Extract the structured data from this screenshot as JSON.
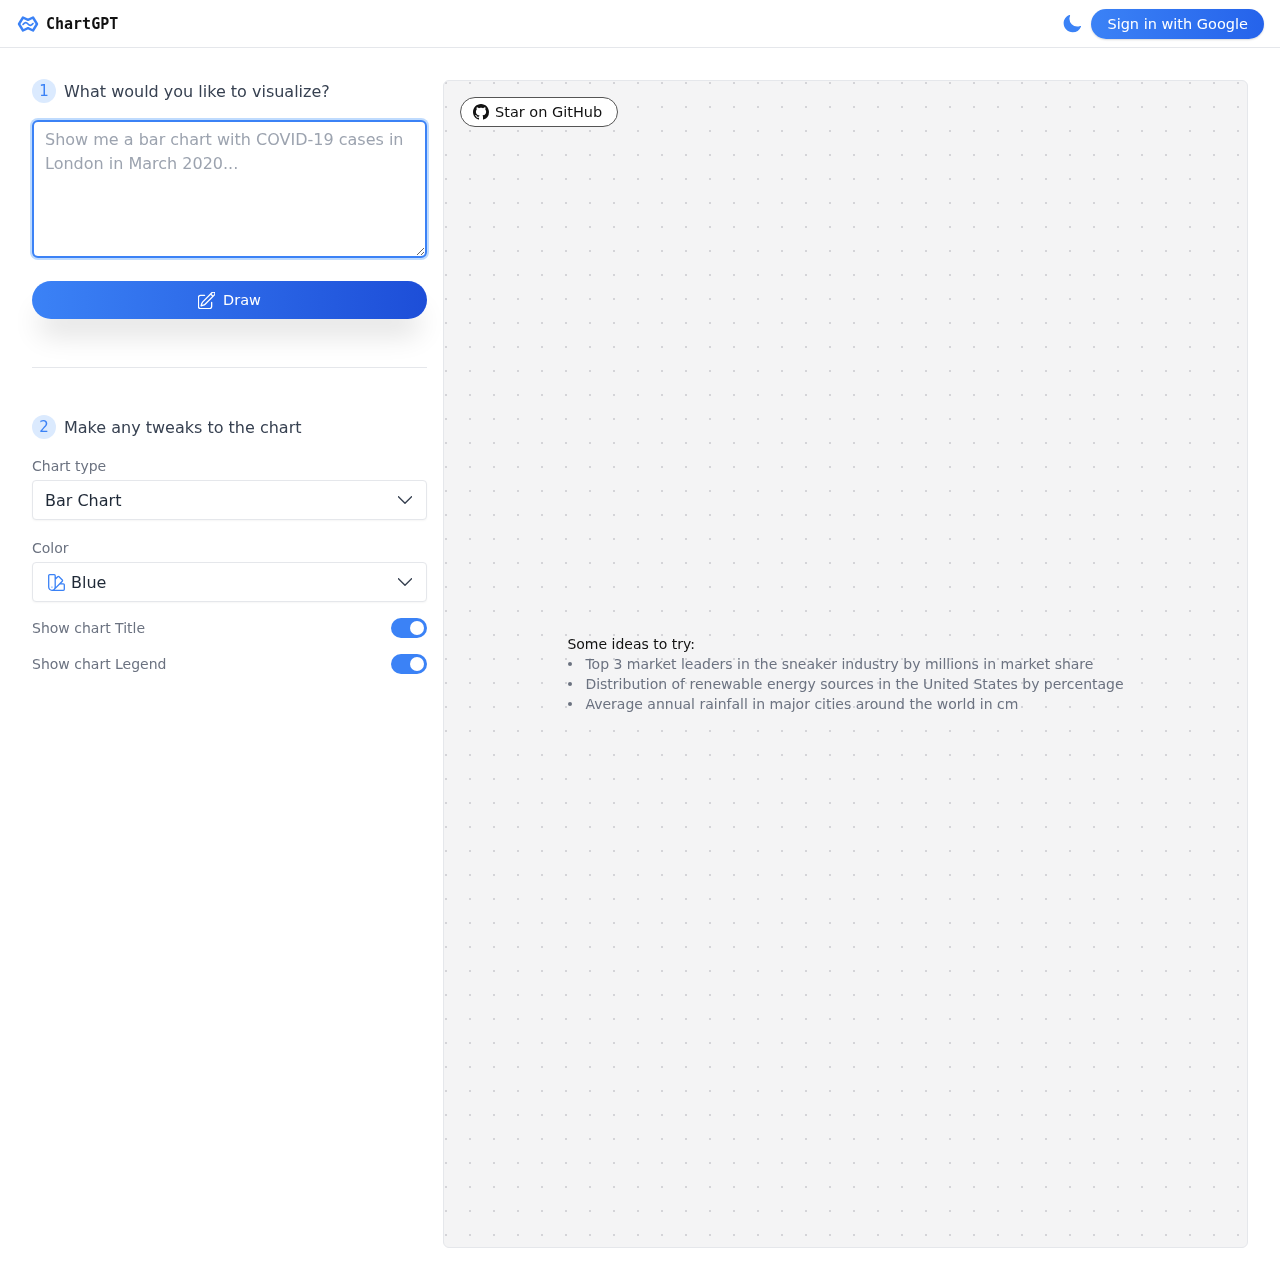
{
  "header": {
    "brand": "ChartGPT",
    "sign_in_button": "Sign in with Google"
  },
  "prompt_section": {
    "step": "1",
    "title": "What would you like to visualize?",
    "prompt_field": {
      "placeholder": "Show me a bar chart with COVID-19 cases in London in March 2020..."
    },
    "draw_button": "Draw"
  },
  "tweaks_section": {
    "step": "2",
    "title": "Make any tweaks to the chart",
    "controls": [
      {
        "kind": "select",
        "label": "Chart type",
        "value": "Bar Chart"
      },
      {
        "kind": "swatch-select",
        "label": "Color",
        "value": "Blue"
      },
      {
        "kind": "toggle",
        "label": "Show chart Title",
        "on": true
      },
      {
        "kind": "toggle",
        "label": "Show chart Legend",
        "on": true
      }
    ]
  },
  "canvas": {
    "github_button": "Star on GitHub",
    "ideas": {
      "heading": "Some ideas to try:",
      "items": [
        "Top 3 market leaders in the sneaker industry by millions in market share",
        "Distribution of renewable energy sources in the United States by percentage",
        "Average annual rainfall in major cities around the world in cm"
      ]
    }
  }
}
